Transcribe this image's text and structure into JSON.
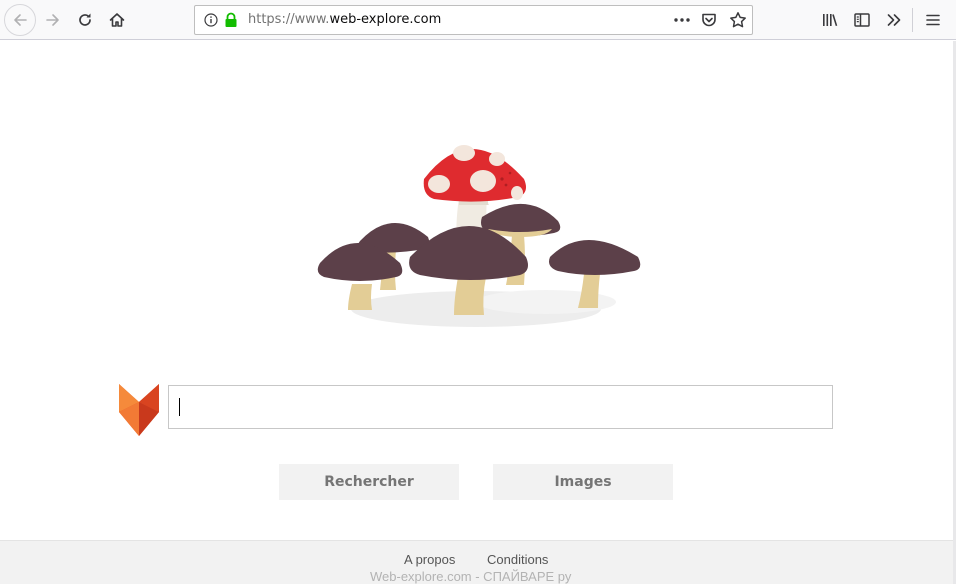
{
  "browser": {
    "url_prefix": "https://www.",
    "url_host": "web-explore.com",
    "toolbar_icons": [
      "back-arrow-icon",
      "forward-arrow-icon",
      "reload-icon",
      "home-icon",
      "site-info-icon",
      "lock-icon",
      "more-actions-icon",
      "pocket-icon",
      "bookmark-star-icon",
      "library-icon",
      "sidebar-icon",
      "overflow-chevron-icon",
      "hamburger-menu-icon"
    ],
    "lock_color": "#12bc00"
  },
  "page": {
    "hero_image": "mushrooms-illustration",
    "logo": "fox-logo",
    "search": {
      "value": "",
      "placeholder": ""
    },
    "buttons": {
      "search_label": "Rechercher",
      "images_label": "Images"
    },
    "footer": {
      "about_label": "A propos",
      "terms_label": "Conditions",
      "watermark": "Web-explore.com - СПАЙВАРЕ ру"
    },
    "colors": {
      "fox_orange": "#e8562a",
      "mushroom_red": "#e0282c",
      "mushroom_brown": "#5b3e4a",
      "button_bg": "#f2f2f2"
    }
  }
}
